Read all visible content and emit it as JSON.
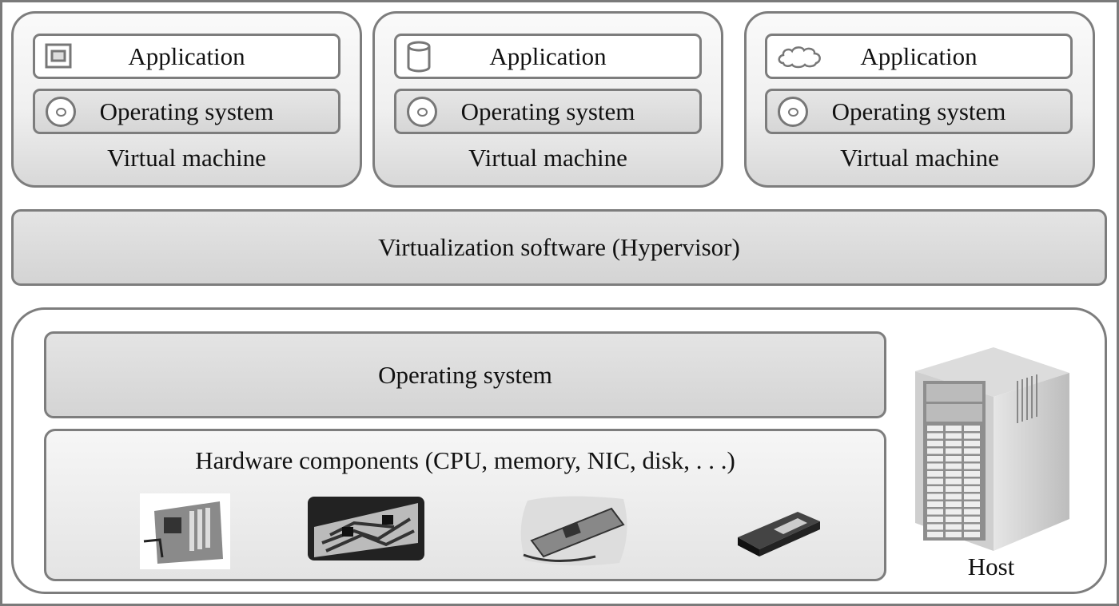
{
  "virtual_machines": [
    {
      "app_label": "Application",
      "app_icon": "window-icon",
      "os_label": "Operating system",
      "os_icon": "disc-icon",
      "vm_label": "Virtual machine"
    },
    {
      "app_label": "Application",
      "app_icon": "database-icon",
      "os_label": "Operating system",
      "os_icon": "disc-icon",
      "vm_label": "Virtual machine"
    },
    {
      "app_label": "Application",
      "app_icon": "cloud-icon",
      "os_label": "Operating system",
      "os_icon": "disc-icon",
      "vm_label": "Virtual machine"
    }
  ],
  "hypervisor": {
    "label": "Virtualization software (Hypervisor)"
  },
  "host": {
    "os_label": "Operating system",
    "hardware_label": "Hardware components (CPU, memory, NIC, disk, . . .)",
    "hardware_icons": [
      "motherboard-icon",
      "memory-icon",
      "nic-card-icon",
      "disk-drive-icon"
    ],
    "host_label": "Host",
    "host_icon": "server-tower-icon"
  }
}
